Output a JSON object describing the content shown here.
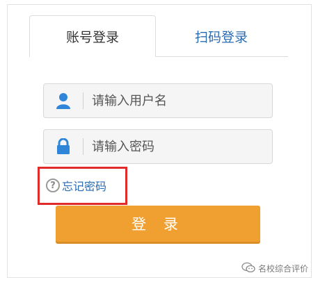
{
  "tabs": [
    {
      "label": "账号登录",
      "active": true
    },
    {
      "label": "扫码登录",
      "active": false
    }
  ],
  "username": {
    "placeholder": "请输入用户名",
    "value": "",
    "icon": "user-icon"
  },
  "password": {
    "placeholder": "请输入密码",
    "value": "",
    "icon": "lock-icon"
  },
  "forgot": {
    "label": "忘记密码",
    "icon": "question-icon",
    "icon_glyph": "?"
  },
  "login_button": {
    "label": "登 录"
  },
  "watermark": {
    "text": "名校综合评价"
  },
  "colors": {
    "accent": "#f0a030",
    "link": "#2a6bb0",
    "icon_blue": "#2f86d8",
    "highlight": "#e12a2a"
  }
}
